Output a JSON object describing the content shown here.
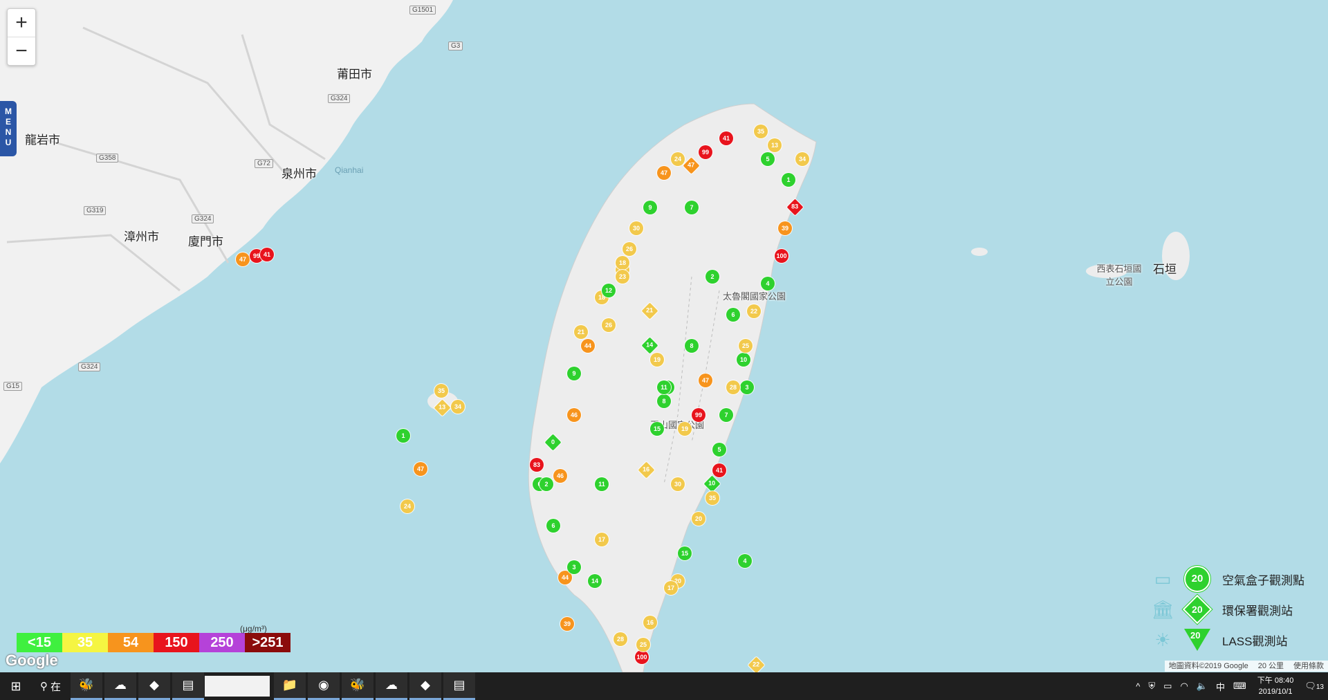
{
  "map": {
    "zoom_in": "+",
    "zoom_out": "−",
    "menu_label": "MENU",
    "place_labels": [
      "莆田市",
      "泉州市",
      "龍岩市",
      "漳州市",
      "廈門市",
      "Qianhai",
      "太魯閣國家公園",
      "玉山國家公園",
      "西表石垣國立公園",
      "石垣"
    ],
    "highway_labels": [
      "G1501",
      "G3",
      "G324",
      "G72",
      "G358",
      "G319",
      "G324",
      "G324",
      "G15"
    ],
    "station_markers": [
      {
        "v": "47",
        "c": "#f7941d"
      },
      {
        "v": "99",
        "c": "#e8141d"
      },
      {
        "v": "41",
        "c": "#e8141d"
      },
      {
        "v": "35",
        "c": "#f2c94c"
      },
      {
        "v": "13",
        "c": "#f2c94c"
      },
      {
        "v": "34",
        "c": "#f2c94c"
      },
      {
        "v": "1",
        "c": "#2ed12e"
      },
      {
        "v": "47",
        "c": "#f7941d"
      },
      {
        "v": "24",
        "c": "#f2c94c"
      },
      {
        "v": "83",
        "c": "#e8141d"
      },
      {
        "v": "39",
        "c": "#f7941d"
      },
      {
        "v": "100",
        "c": "#e8141d"
      },
      {
        "v": "4",
        "c": "#2ed12e"
      },
      {
        "v": "22",
        "c": "#f2c94c"
      },
      {
        "v": "25",
        "c": "#f2c94c"
      },
      {
        "v": "28",
        "c": "#f2c94c"
      },
      {
        "v": "7",
        "c": "#2ed12e"
      },
      {
        "v": "5",
        "c": "#2ed12e"
      },
      {
        "v": "10",
        "c": "#2ed12e"
      },
      {
        "v": "20",
        "c": "#f2c94c"
      },
      {
        "v": "15",
        "c": "#2ed12e"
      },
      {
        "v": "17",
        "c": "#f2c94c"
      },
      {
        "v": "16",
        "c": "#f2c94c"
      },
      {
        "v": "18",
        "c": "#f2c94c"
      },
      {
        "v": "12",
        "c": "#2ed12e"
      },
      {
        "v": "44",
        "c": "#f7941d"
      },
      {
        "v": "46",
        "c": "#f7941d"
      },
      {
        "v": "0",
        "c": "#2ed12e"
      },
      {
        "v": "2",
        "c": "#2ed12e"
      },
      {
        "v": "6",
        "c": "#2ed12e"
      },
      {
        "v": "3",
        "c": "#2ed12e"
      },
      {
        "v": "14",
        "c": "#2ed12e"
      },
      {
        "v": "9",
        "c": "#2ed12e"
      },
      {
        "v": "30",
        "c": "#f2c94c"
      },
      {
        "v": "26",
        "c": "#f2c94c"
      },
      {
        "v": "23",
        "c": "#f2c94c"
      },
      {
        "v": "21",
        "c": "#f2c94c"
      },
      {
        "v": "19",
        "c": "#f2c94c"
      },
      {
        "v": "11",
        "c": "#2ed12e"
      },
      {
        "v": "8",
        "c": "#2ed12e"
      }
    ],
    "attribution": [
      "地圖資料©2019 Google",
      "20 公里",
      "使用條款"
    ],
    "google_logo": "Google"
  },
  "scale": {
    "unit": "(μg/m³)",
    "levels": [
      {
        "label": "<15",
        "color": "#3ff03f"
      },
      {
        "label": "35",
        "color": "#f5f542"
      },
      {
        "label": "54",
        "color": "#f7941d"
      },
      {
        "label": "150",
        "color": "#e8141d"
      },
      {
        "label": "250",
        "color": "#b542d9"
      },
      {
        "label": ">251",
        "color": "#8b0b0b"
      }
    ]
  },
  "legend": {
    "items": [
      {
        "sample": "20",
        "label": "空氣盒子觀測點",
        "icon": "airbox-icon"
      },
      {
        "sample": "20",
        "label": "環保署觀測站",
        "icon": "government-building-icon"
      },
      {
        "sample": "20",
        "label": "LASS觀測站",
        "icon": "lass-station-icon"
      }
    ]
  },
  "taskbar": {
    "search_text": "在",
    "apps": [
      "start-icon",
      "search-icon",
      "app-icon",
      "app-icon",
      "app-icon",
      "app-icon",
      "file-explorer-icon",
      "chrome-icon",
      "app-icon",
      "app-icon",
      "app-icon",
      "app-icon"
    ],
    "ime": "中",
    "time": "下午 08:40",
    "date": "2019/10/1",
    "notifications": "13"
  }
}
